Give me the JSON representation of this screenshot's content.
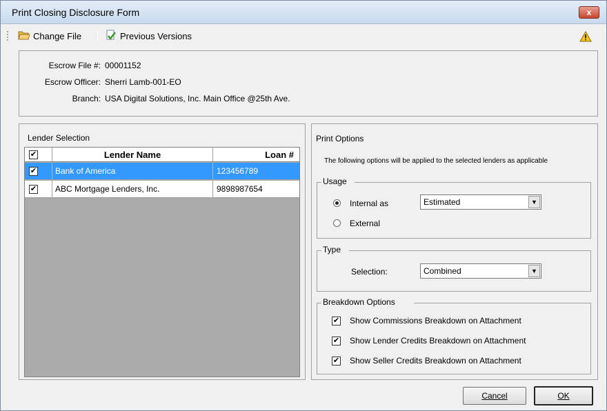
{
  "window": {
    "title": "Print Closing Disclosure Form",
    "close_label": "x"
  },
  "toolbar": {
    "change_file": "Change File",
    "previous_versions": "Previous Versions"
  },
  "info": {
    "escrow_file_label": "Escrow File #:",
    "escrow_file_value": "00001152",
    "escrow_officer_label": "Escrow Officer:",
    "escrow_officer_value": "Sherri Lamb-001-EO",
    "branch_label": "Branch:",
    "branch_value": "USA Digital Solutions, Inc. Main Office @25th Ave."
  },
  "lender_selection": {
    "title": "Lender Selection",
    "columns": [
      "Lender Name",
      "Loan #"
    ],
    "rows": [
      {
        "checked": true,
        "name": "Bank of America",
        "loan": "123456789",
        "selected": true
      },
      {
        "checked": true,
        "name": "ABC Mortgage Lenders, Inc.",
        "loan": "9898987654",
        "selected": false
      }
    ]
  },
  "print_options": {
    "title": "Print Options",
    "description": "The following options will be applied to the selected lenders as applicable",
    "usage": {
      "title": "Usage",
      "internal_label": "Internal as",
      "external_label": "External",
      "internal_selected": true,
      "internal_value": "Estimated"
    },
    "type": {
      "title": "Type",
      "selection_label": "Selection:",
      "selection_value": "Combined"
    },
    "breakdown": {
      "title": "Breakdown Options",
      "items": [
        {
          "label": "Show Commissions Breakdown on Attachment",
          "checked": true
        },
        {
          "label": "Show Lender Credits Breakdown on Attachment",
          "checked": true
        },
        {
          "label": "Show Seller Credits Breakdown on Attachment",
          "checked": true
        }
      ]
    }
  },
  "buttons": {
    "cancel": "Cancel",
    "ok": "OK"
  },
  "check_mark": "✔",
  "dropdown_arrow": "▼"
}
